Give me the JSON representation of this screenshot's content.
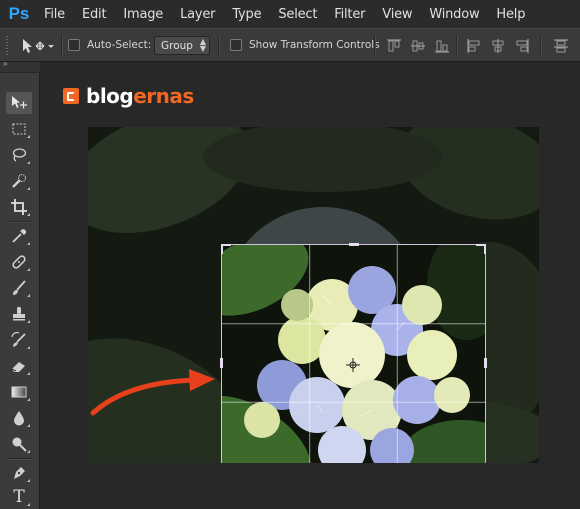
{
  "app": {
    "logo_text": "Ps"
  },
  "menu": [
    "File",
    "Edit",
    "Image",
    "Layer",
    "Type",
    "Select",
    "Filter",
    "View",
    "Window",
    "Help"
  ],
  "options": {
    "auto_select_label": "Auto-Select:",
    "auto_select_checked": false,
    "group_value": "Group",
    "show_transform_label": "Show Transform Controls",
    "show_transform_checked": false
  },
  "tools_header": "»",
  "tools": [
    "move-tool",
    "marquee-tool",
    "lasso-tool",
    "quick-selection-tool",
    "crop-tool",
    "eyedropper-tool",
    "healing-brush-tool",
    "brush-tool",
    "clone-stamp-tool",
    "history-brush-tool",
    "eraser-tool",
    "gradient-tool",
    "blur-tool",
    "dodge-tool",
    "pen-tool",
    "type-tool"
  ],
  "type_tool_glyph": "T",
  "brand": {
    "part1": "blog",
    "part2": "ernas",
    "accent_color": "#f26722"
  },
  "colors": {
    "accent_photoshop": "#31a8ff",
    "arrow": "#e8401c",
    "crop_handle": "#e6dcf0"
  }
}
